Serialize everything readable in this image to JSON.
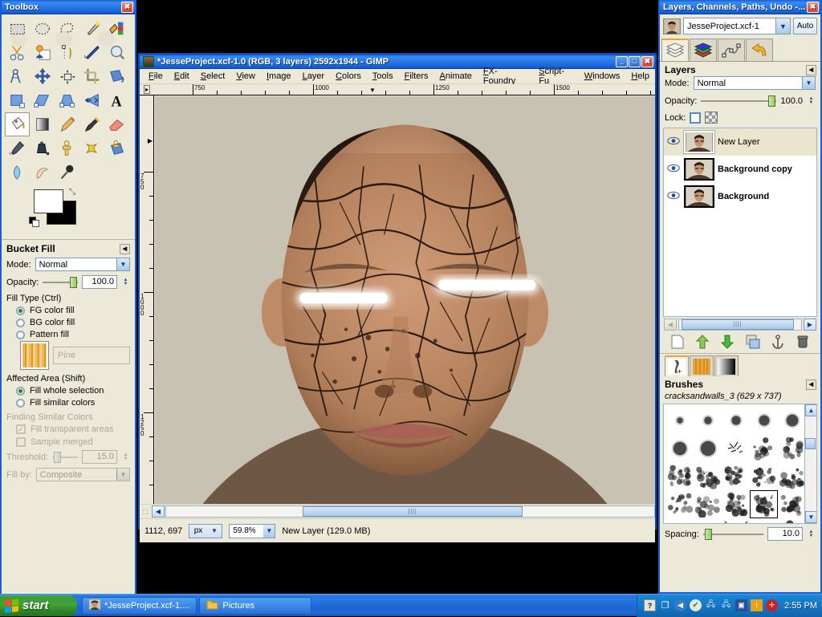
{
  "toolbox": {
    "title": "Toolbox",
    "close_label": "✖",
    "tools": [
      {
        "name": "rect-select-tool",
        "label": "Rectangle Select"
      },
      {
        "name": "ellipse-select-tool",
        "label": "Ellipse Select"
      },
      {
        "name": "free-select-tool",
        "label": "Free Select"
      },
      {
        "name": "fuzzy-select-tool",
        "label": "Fuzzy Select"
      },
      {
        "name": "select-by-color-tool",
        "label": "Select by Color"
      },
      {
        "name": "scissors-select-tool",
        "label": "Scissors Select"
      },
      {
        "name": "foreground-select-tool",
        "label": "Foreground Select"
      },
      {
        "name": "paths-tool",
        "label": "Paths"
      },
      {
        "name": "color-picker-tool",
        "label": "Color Picker"
      },
      {
        "name": "zoom-tool",
        "label": "Zoom"
      },
      {
        "name": "measure-tool",
        "label": "Measure"
      },
      {
        "name": "move-tool",
        "label": "Move"
      },
      {
        "name": "align-tool",
        "label": "Alignment"
      },
      {
        "name": "crop-tool",
        "label": "Crop"
      },
      {
        "name": "rotate-tool",
        "label": "Rotate"
      },
      {
        "name": "scale-tool",
        "label": "Scale"
      },
      {
        "name": "shear-tool",
        "label": "Shear"
      },
      {
        "name": "perspective-tool",
        "label": "Perspective"
      },
      {
        "name": "flip-tool",
        "label": "Flip"
      },
      {
        "name": "text-tool",
        "label": "Text"
      },
      {
        "name": "bucket-fill-tool",
        "label": "Bucket Fill"
      },
      {
        "name": "blend-tool",
        "label": "Blend"
      },
      {
        "name": "pencil-tool",
        "label": "Pencil"
      },
      {
        "name": "paintbrush-tool",
        "label": "Paintbrush"
      },
      {
        "name": "eraser-tool",
        "label": "Eraser"
      },
      {
        "name": "airbrush-tool",
        "label": "Airbrush"
      },
      {
        "name": "ink-tool",
        "label": "Ink"
      },
      {
        "name": "clone-tool",
        "label": "Clone"
      },
      {
        "name": "heal-tool",
        "label": "Heal"
      },
      {
        "name": "perspective-clone-tool",
        "label": "Perspective Clone"
      },
      {
        "name": "blur-sharpen-tool",
        "label": "Blur / Sharpen"
      },
      {
        "name": "smudge-tool",
        "label": "Smudge"
      },
      {
        "name": "dodge-burn-tool",
        "label": "Dodge / Burn"
      }
    ],
    "selected_tool_index": 20,
    "colors": {
      "foreground": "#ffffff",
      "background": "#000000"
    }
  },
  "tool_options": {
    "title": "Bucket Fill",
    "mode_label": "Mode:",
    "mode_value": "Normal",
    "opacity_label": "Opacity:",
    "opacity_value": "100.0",
    "fill_type_label": "Fill Type  (Ctrl)",
    "fill_types": [
      {
        "label": "FG color fill",
        "selected": true
      },
      {
        "label": "BG color fill",
        "selected": false
      },
      {
        "label": "Pattern fill",
        "selected": false
      }
    ],
    "pattern_name": "Pine",
    "affected_area_label": "Affected Area  (Shift)",
    "affected_areas": [
      {
        "label": "Fill whole selection",
        "selected": true
      },
      {
        "label": "Fill similar colors",
        "selected": false
      }
    ],
    "finding_label": "Finding Similar Colors",
    "fill_transparent_label": "Fill transparent areas",
    "fill_transparent_checked": true,
    "sample_merged_label": "Sample merged",
    "sample_merged_checked": false,
    "threshold_label": "Threshold:",
    "threshold_value": "15.0",
    "fill_by_label": "Fill by:",
    "fill_by_value": "Composite"
  },
  "image_window": {
    "title": "*JesseProject.xcf-1.0 (RGB, 3 layers) 2592x1944 - GIMP",
    "minimize_label": "_",
    "maximize_label": "□",
    "close_label": "✖",
    "menus": [
      "File",
      "Edit",
      "Select",
      "View",
      "Image",
      "Layer",
      "Colors",
      "Tools",
      "Filters",
      "Animate",
      "FX-Foundry",
      "Script-Fu",
      "Windows",
      "Help"
    ],
    "ruler_h_labels": [
      "750",
      "1000",
      "1250",
      "1500"
    ],
    "ruler_v_labels": [
      "750",
      "1000",
      "1250"
    ],
    "status": {
      "position": "1112, 697",
      "unit": "px",
      "zoom": "59.8%",
      "layer_info": "New Layer (129.0 MB)"
    }
  },
  "dock": {
    "title": "Layers, Channels, Paths, Undo -...",
    "close_label": "✖",
    "image_name": "JesseProject.xcf-1",
    "auto_label": "Auto",
    "tabs": [
      {
        "name": "layers-tab",
        "label": "Layers",
        "selected": true
      },
      {
        "name": "channels-tab",
        "label": "Channels",
        "selected": false
      },
      {
        "name": "paths-tab",
        "label": "Paths",
        "selected": false
      },
      {
        "name": "undo-tab",
        "label": "Undo History",
        "selected": false
      }
    ],
    "layers_panel": {
      "title": "Layers",
      "mode_label": "Mode:",
      "mode_value": "Normal",
      "opacity_label": "Opacity:",
      "opacity_value": "100.0",
      "lock_label": "Lock:",
      "layers": [
        {
          "name": "New Layer",
          "visible": true,
          "selected": true
        },
        {
          "name": "Background copy",
          "visible": true,
          "selected": false
        },
        {
          "name": "Background",
          "visible": true,
          "selected": false
        }
      ],
      "buttons": [
        {
          "name": "new-layer-button",
          "label": "□"
        },
        {
          "name": "raise-layer-button",
          "label": "⬆"
        },
        {
          "name": "lower-layer-button",
          "label": "⬇"
        },
        {
          "name": "duplicate-layer-button",
          "label": "⧉"
        },
        {
          "name": "anchor-layer-button",
          "label": "⚓"
        },
        {
          "name": "delete-layer-button",
          "label": "🗑"
        }
      ]
    },
    "brushes_panel": {
      "title": "Brushes",
      "current_brush": "cracksandwalls_3 (629 x 737)",
      "spacing_label": "Spacing:",
      "spacing_value": "10.0",
      "selected_index": 18
    }
  },
  "taskbar": {
    "start_label": "start",
    "items": [
      {
        "name": "taskbar-item-gimp",
        "label": "*JesseProject.xcf-1....",
        "icon": "photo-icon"
      },
      {
        "name": "taskbar-item-pictures",
        "label": "Pictures",
        "icon": "folder-icon"
      }
    ],
    "clock": "2:55 PM"
  }
}
